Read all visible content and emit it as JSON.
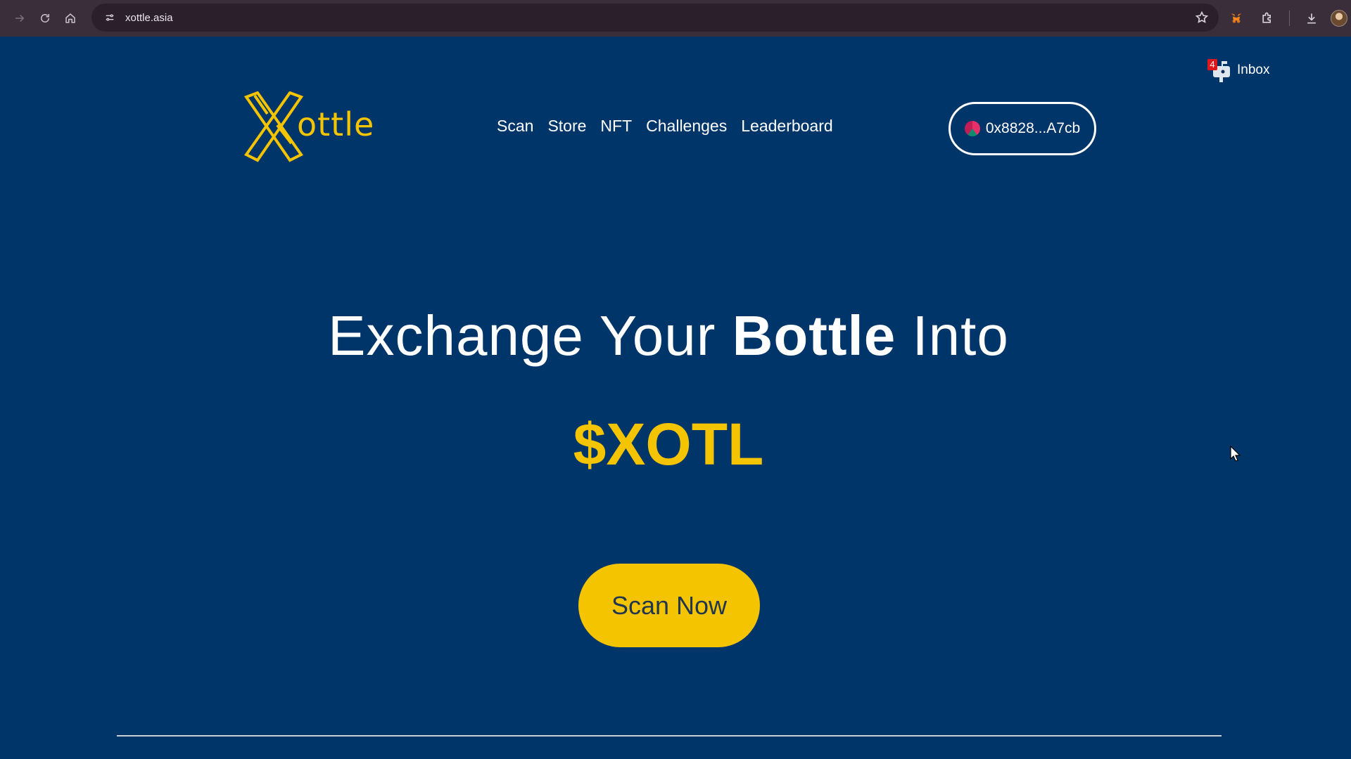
{
  "browser": {
    "url": "xottle.asia"
  },
  "inbox": {
    "badge_count": "4",
    "label": "Inbox"
  },
  "logo": {
    "text": "ottle"
  },
  "nav": {
    "items": [
      {
        "label": "Scan"
      },
      {
        "label": "Store"
      },
      {
        "label": "NFT"
      },
      {
        "label": "Challenges"
      },
      {
        "label": "Leaderboard"
      }
    ]
  },
  "wallet": {
    "address": "0x8828...A7cb"
  },
  "hero": {
    "line1_pre": "Exchange Your",
    "line1_bold": "Bottle",
    "line1_post": "Into",
    "token": "$XOTL",
    "cta": "Scan Now"
  },
  "colors": {
    "background": "#00356a",
    "accent": "#f5c400",
    "browser_bar": "#3a2e3b"
  }
}
